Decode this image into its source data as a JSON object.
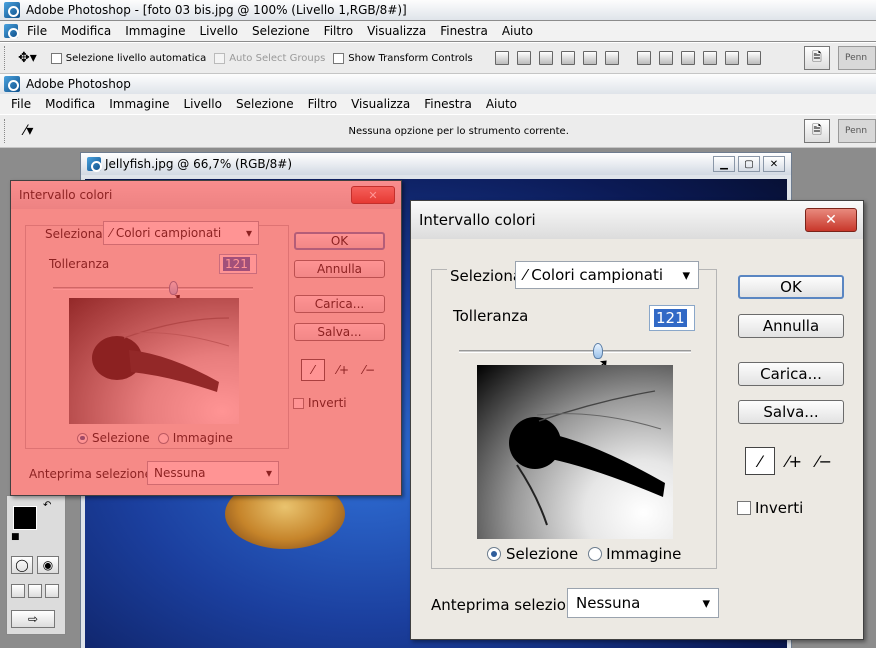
{
  "app_top": {
    "title": "Adobe Photoshop - [foto 03 bis.jpg @ 100% (Livello 1,RGB/8#)]"
  },
  "app_bottom": {
    "title": "Adobe Photoshop"
  },
  "menu_top": [
    "File",
    "Modifica",
    "Immagine",
    "Livello",
    "Selezione",
    "Filtro",
    "Visualizza",
    "Finestra",
    "Aiuto"
  ],
  "menu_bottom": [
    "File",
    "Modifica",
    "Immagine",
    "Livello",
    "Selezione",
    "Filtro",
    "Visualizza",
    "Finestra",
    "Aiuto"
  ],
  "options_top": {
    "auto_select_layer": "Selezione livello automatica",
    "auto_select_groups": "Auto Select Groups",
    "show_transform": "Show Transform Controls",
    "panel_tab": "Penn"
  },
  "options_bottom": {
    "message": "Nessuna opzione per lo strumento corrente.",
    "panel_tab": "Penn"
  },
  "document": {
    "title": "Jellyfish.jpg @ 66,7% (RGB/8#)"
  },
  "dialog": {
    "title": "Intervallo colori",
    "select_label": "Seleziona:",
    "select_value": "Colori campionati",
    "tolerance_label": "Tolleranza",
    "tolerance_value": "121",
    "tolerance_fraction": 0.6,
    "buttons": {
      "ok": "OK",
      "cancel": "Annulla",
      "load": "Carica...",
      "save": "Salva..."
    },
    "invert_label": "Inverti",
    "radio_selection": "Selezione",
    "radio_image": "Immagine",
    "preview_label": "Anteprima selezione:",
    "preview_value": "Nessuna"
  },
  "colors": {
    "overlay": "#ff3c3c",
    "selection_blue": "#3169c6",
    "ok_border": "#5a86c2"
  }
}
